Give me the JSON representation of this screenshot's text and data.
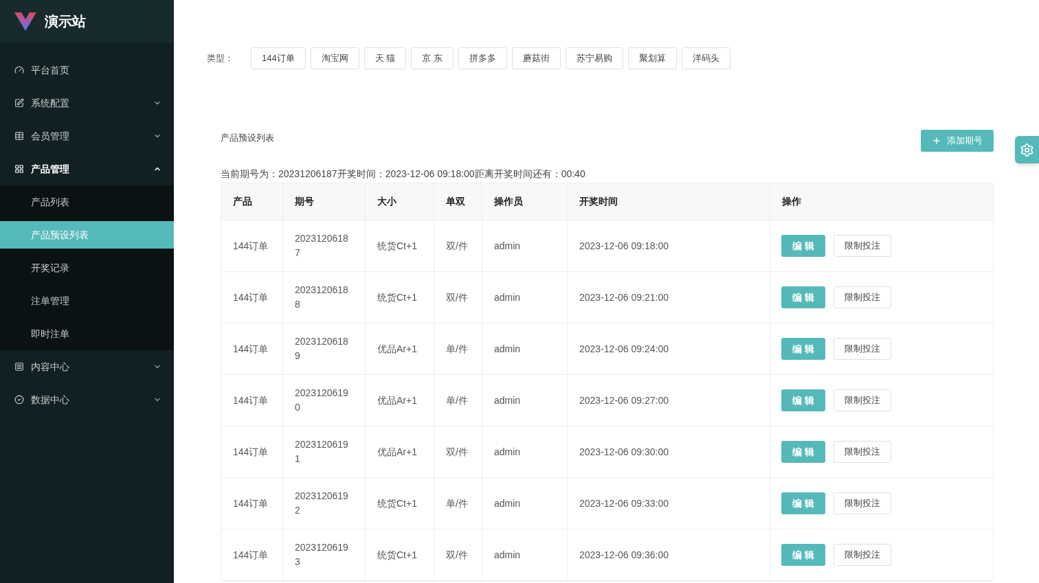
{
  "brand": {
    "title": "演示站"
  },
  "sidebar": {
    "items": [
      {
        "kind": "link",
        "label": "平台首页"
      },
      {
        "kind": "group",
        "label": "系统配置",
        "expanded": false
      },
      {
        "kind": "group",
        "label": "会员管理",
        "expanded": false
      },
      {
        "kind": "group",
        "label": "产品管理",
        "expanded": true,
        "children": [
          {
            "label": "产品列表",
            "selected": false
          },
          {
            "label": "产品预设列表",
            "selected": true
          },
          {
            "label": "开奖记录",
            "selected": false
          },
          {
            "label": "注单管理",
            "selected": false
          },
          {
            "label": "即时注单",
            "selected": false
          }
        ]
      },
      {
        "kind": "group",
        "label": "内容中心",
        "expanded": false
      },
      {
        "kind": "group",
        "label": "数据中心",
        "expanded": false
      }
    ]
  },
  "filter": {
    "label": "类型：",
    "options": [
      "144订单",
      "淘宝网",
      "天 猫",
      "京 东",
      "拼多多",
      "蘑菇街",
      "苏宁易购",
      "聚划算",
      "洋码头"
    ]
  },
  "section_title": "产品预设列表",
  "add_button": "添加期号",
  "current_info": "当前期号为：20231206187开奖时间：2023-12-06 09:18:00距离开奖时间还有：00:40",
  "table": {
    "columns": [
      "产品",
      "期号",
      "大小",
      "单双",
      "操作员",
      "开奖时间",
      "操作"
    ],
    "rows": [
      {
        "product": "144订单",
        "period": "20231206187",
        "size": "统货Ct+1",
        "parity": "双/件",
        "operator": "admin",
        "time": "2023-12-06 09:18:00",
        "actions": [
          "编 辑",
          "限制投注"
        ]
      },
      {
        "product": "144订单",
        "period": "20231206188",
        "size": "统货Ct+1",
        "parity": "双/件",
        "operator": "admin",
        "time": "2023-12-06 09:21:00",
        "actions": [
          "编 辑",
          "限制投注"
        ]
      },
      {
        "product": "144订单",
        "period": "20231206189",
        "size": "优品Ar+1",
        "parity": "单/件",
        "operator": "admin",
        "time": "2023-12-06 09:24:00",
        "actions": [
          "编 辑",
          "限制投注"
        ]
      },
      {
        "product": "144订单",
        "period": "20231206190",
        "size": "优品Ar+1",
        "parity": "单/件",
        "operator": "admin",
        "time": "2023-12-06 09:27:00",
        "actions": [
          "编 辑",
          "限制投注"
        ]
      },
      {
        "product": "144订单",
        "period": "20231206191",
        "size": "优品Ar+1",
        "parity": "双/件",
        "operator": "admin",
        "time": "2023-12-06 09:30:00",
        "actions": [
          "编 辑",
          "限制投注"
        ]
      },
      {
        "product": "144订单",
        "period": "20231206192",
        "size": "统货Ct+1",
        "parity": "单/件",
        "operator": "admin",
        "time": "2023-12-06 09:33:00",
        "actions": [
          "编 辑",
          "限制投注"
        ]
      },
      {
        "product": "144订单",
        "period": "20231206193",
        "size": "统货Ct+1",
        "parity": "双/件",
        "operator": "admin",
        "time": "2023-12-06 09:36:00",
        "actions": [
          "编 辑",
          "限制投注"
        ]
      }
    ]
  }
}
